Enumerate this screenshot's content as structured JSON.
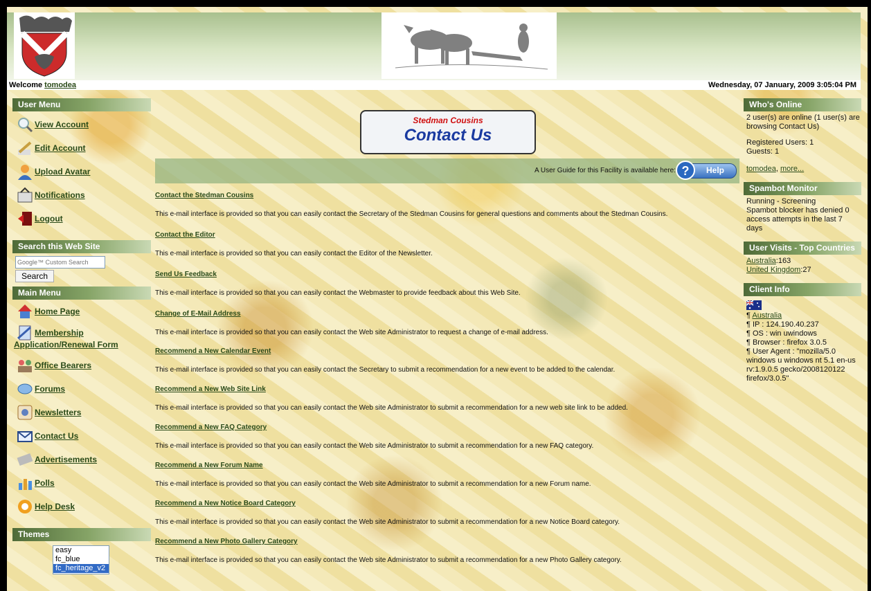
{
  "header": {
    "welcome_prefix": "Welcome ",
    "username": "tomodea",
    "datetime": "Wednesday, 07 January, 2009 3:05:04 PM"
  },
  "user_menu": {
    "title": "User Menu",
    "items": [
      {
        "label": "View Account",
        "icon": "magnifier-icon"
      },
      {
        "label": "Edit Account",
        "icon": "pencil-icon"
      },
      {
        "label": "Upload Avatar",
        "icon": "avatar-icon"
      },
      {
        "label": "Notifications",
        "icon": "notification-icon"
      },
      {
        "label": "Logout",
        "icon": "logout-icon"
      }
    ]
  },
  "search": {
    "title": "Search this Web Site",
    "placeholder": "Google™ Custom Search",
    "button": "Search"
  },
  "main_menu": {
    "title": "Main Menu",
    "items": [
      {
        "label": "Home Page",
        "icon": "home-icon"
      },
      {
        "label": "Membership Application/Renewal Form",
        "icon": "form-icon"
      },
      {
        "label": "Office Bearers",
        "icon": "people-icon"
      },
      {
        "label": "Forums",
        "icon": "forum-icon"
      },
      {
        "label": "Newsletters",
        "icon": "newsletter-icon"
      },
      {
        "label": "Contact Us",
        "icon": "envelope-icon"
      },
      {
        "label": "Advertisements",
        "icon": "advert-icon"
      },
      {
        "label": "Polls",
        "icon": "poll-icon"
      },
      {
        "label": "Help Desk",
        "icon": "lifebuoy-icon"
      }
    ]
  },
  "themes": {
    "title": "Themes",
    "options": [
      "easy",
      "fc_blue",
      "fc_heritage_v2"
    ]
  },
  "center": {
    "subtitle": "Stedman Cousins",
    "title": "Contact Us",
    "guide_text": "A User Guide for this Facility is available here:",
    "help_label": "Help",
    "items": [
      {
        "title": "Contact the Stedman Cousins",
        "desc": "This e-mail interface is provided so that you can easily contact the Secretary of the Stedman Cousins for general questions and comments about the Stedman Cousins."
      },
      {
        "title": "Contact the Editor",
        "desc": "This e-mail interface is provided so that you can easily contact the Editor of the Newsletter."
      },
      {
        "title": "Send Us Feedback",
        "desc": "This e-mail interface is provided so that you can easily contact the Webmaster to provide feedback about this Web Site."
      },
      {
        "title": "Change of E-Mail Address",
        "desc": "This e-mail interface is provided so that you can easily contact the Web site Administrator to request a change of e-mail address."
      },
      {
        "title": "Recommend a New Calendar Event",
        "desc": "This e-mail interface is provided so that you can easily contact the Secretary to submit a recommendation for a new event to be added to the calendar."
      },
      {
        "title": "Recommend a New Web Site Link",
        "desc": "This e-mail interface is provided so that you can easily contact the Web site Administrator to submit a recommendation for a new web site link to be added."
      },
      {
        "title": "Recommend a New FAQ Category",
        "desc": "This e-mail interface is provided so that you can easily contact the Web site Administrator to submit a recommendation for a new FAQ category."
      },
      {
        "title": "Recommend a New Forum Name",
        "desc": "This e-mail interface is provided so that you can easily contact the Web site Administrator to submit a recommendation for a new Forum name."
      },
      {
        "title": "Recommend a New Notice Board Category",
        "desc": "This e-mail interface is provided so that you can easily contact the Web site Administrator to submit a recommendation for a new Notice Board category."
      },
      {
        "title": "Recommend a New Photo Gallery Category",
        "desc": "This e-mail interface is provided so that you can easily contact the Web site Administrator to submit a recommendation for a new Photo Gallery category."
      }
    ]
  },
  "whos_online": {
    "title": "Who's Online",
    "summary": "2 user(s) are online (1 user(s) are browsing Contact Us)",
    "registered": "Registered Users: 1",
    "guests": "Guests: 1",
    "user_link": "tomodea",
    "sep": ", ",
    "more_link": "more..."
  },
  "spambot": {
    "title": "Spambot Monitor",
    "status": "Running - Screening",
    "detail": "Spambot blocker has denied 0 access attempts in the last 7 days"
  },
  "visits": {
    "title": "User Visits - Top Countries",
    "rows": [
      {
        "country": "Australia",
        "count": ":163"
      },
      {
        "country": "United Kingdom",
        "count": ":27"
      }
    ]
  },
  "client_info": {
    "title": "Client Info",
    "country": "Australia",
    "ip": "¶ IP : 124.190.40.237",
    "os": "¶ OS : win uwindows",
    "browser": "¶ Browser : firefox 3.0.5",
    "agent": "¶ User Agent : \"mozilla/5.0 windows u windows nt 5.1 en-us rv:1.9.0.5 gecko/2008120122 firefox/3.0.5\""
  }
}
